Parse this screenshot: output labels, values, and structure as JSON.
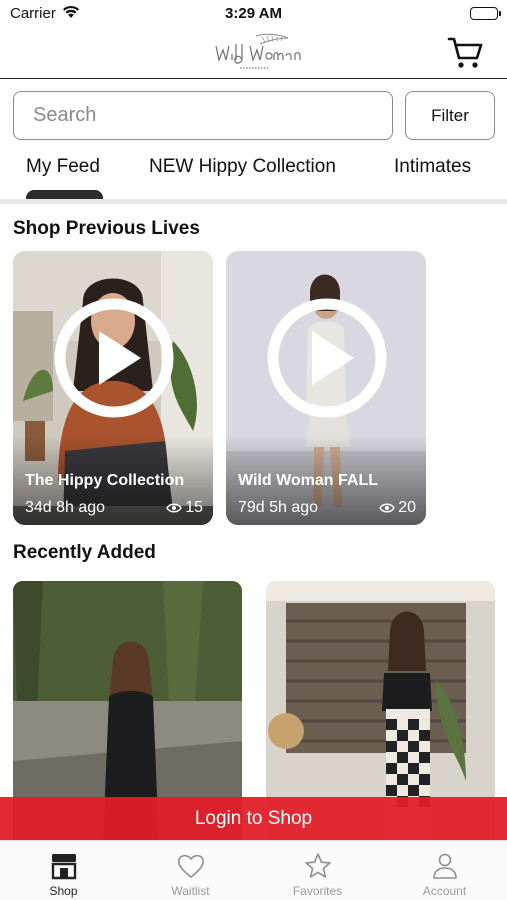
{
  "status_bar": {
    "carrier": "Carrier",
    "time": "3:29 AM"
  },
  "header": {
    "logo_icon": "wild-woman-boutique-logo",
    "cart_icon": "shopping-cart-icon"
  },
  "search": {
    "placeholder": "Search",
    "value": "",
    "filter_label": "Filter"
  },
  "tabs": [
    {
      "label": "My Feed",
      "active": true
    },
    {
      "label": "NEW Hippy Collection",
      "active": false
    },
    {
      "label": "Intimates",
      "active": false
    }
  ],
  "previous_lives": {
    "title": "Shop Previous Lives",
    "items": [
      {
        "title": "The Hippy Collection",
        "time_ago": "34d 8h ago",
        "views": "15"
      },
      {
        "title": "Wild Woman FALL",
        "time_ago": "79d 5h ago",
        "views": "20"
      }
    ]
  },
  "recently_added": {
    "title": "Recently Added"
  },
  "login_banner": {
    "label": "Login to Shop"
  },
  "tab_bar": [
    {
      "label": "Shop",
      "icon": "storefront-icon",
      "active": true
    },
    {
      "label": "Waitlist",
      "icon": "heart-icon",
      "active": false
    },
    {
      "label": "Favorites",
      "icon": "star-icon",
      "active": false
    },
    {
      "label": "Account",
      "icon": "person-icon",
      "active": false
    }
  ],
  "colors": {
    "accent_red": "#e21e28",
    "tab_indicator": "#2b2b2b",
    "muted_gray": "#9a9a9a"
  }
}
